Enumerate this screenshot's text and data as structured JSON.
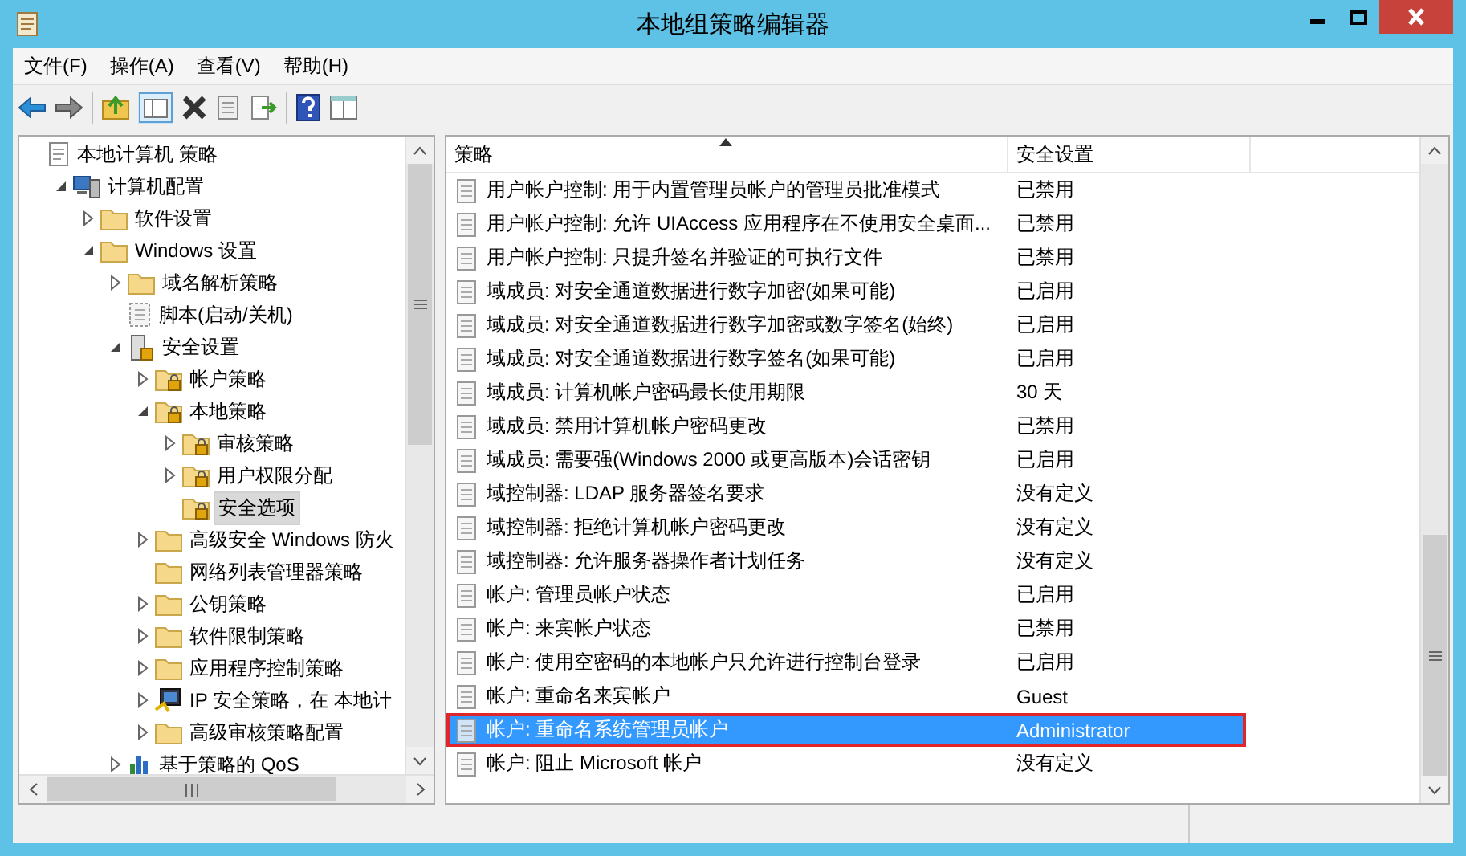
{
  "window": {
    "title": "本地组策略编辑器"
  },
  "menu": [
    "文件(F)",
    "操作(A)",
    "查看(V)",
    "帮助(H)"
  ],
  "tree": [
    {
      "label": "本地计算机 策略",
      "kind": "policy",
      "selected": false,
      "children": [
        {
          "label": "计算机配置",
          "kind": "computer",
          "expanded": true,
          "selected": false,
          "children": [
            {
              "label": "软件设置",
              "kind": "folder",
              "expanded": false,
              "selected": false
            },
            {
              "label": "Windows 设置",
              "kind": "folder",
              "expanded": true,
              "selected": false,
              "children": [
                {
                  "label": "域名解析策略",
                  "kind": "folder",
                  "expanded": false,
                  "selected": false
                },
                {
                  "label": "脚本(启动/关机)",
                  "kind": "script",
                  "selected": false
                },
                {
                  "label": "安全设置",
                  "kind": "security",
                  "expanded": true,
                  "selected": false,
                  "children": [
                    {
                      "label": "帐户策略",
                      "kind": "lockfolder",
                      "expanded": false,
                      "selected": false
                    },
                    {
                      "label": "本地策略",
                      "kind": "lockfolder",
                      "expanded": true,
                      "selected": false,
                      "children": [
                        {
                          "label": "审核策略",
                          "kind": "lockfolder",
                          "expanded": false,
                          "selected": false
                        },
                        {
                          "label": "用户权限分配",
                          "kind": "lockfolder",
                          "expanded": false,
                          "selected": false
                        },
                        {
                          "label": "安全选项",
                          "kind": "lockfolder",
                          "selected": true
                        }
                      ]
                    },
                    {
                      "label": "高级安全 Windows 防火",
                      "kind": "folder",
                      "expanded": false,
                      "selected": false
                    },
                    {
                      "label": "网络列表管理器策略",
                      "kind": "folder",
                      "selected": false
                    },
                    {
                      "label": "公钥策略",
                      "kind": "folder",
                      "expanded": false,
                      "selected": false
                    },
                    {
                      "label": "软件限制策略",
                      "kind": "folder",
                      "expanded": false,
                      "selected": false
                    },
                    {
                      "label": "应用程序控制策略",
                      "kind": "folder",
                      "expanded": false,
                      "selected": false
                    },
                    {
                      "label": "IP 安全策略，在 本地计",
                      "kind": "network",
                      "expanded": false,
                      "selected": false
                    },
                    {
                      "label": "高级审核策略配置",
                      "kind": "folder",
                      "expanded": false,
                      "selected": false
                    }
                  ]
                },
                {
                  "label": "基于策略的 QoS",
                  "kind": "chart",
                  "expanded": false,
                  "selected": false
                }
              ]
            }
          ]
        }
      ]
    }
  ],
  "table": {
    "columns": [
      "策略",
      "安全设置"
    ],
    "rows": [
      {
        "policy": "用户帐户控制: 用于内置管理员帐户的管理员批准模式",
        "setting": "已禁用",
        "selected": false,
        "outlined": false
      },
      {
        "policy": "用户帐户控制: 允许 UIAccess 应用程序在不使用安全桌面...",
        "setting": "已禁用",
        "selected": false,
        "outlined": false
      },
      {
        "policy": "用户帐户控制: 只提升签名并验证的可执行文件",
        "setting": "已禁用",
        "selected": false,
        "outlined": false
      },
      {
        "policy": "域成员: 对安全通道数据进行数字加密(如果可能)",
        "setting": "已启用",
        "selected": false,
        "outlined": false
      },
      {
        "policy": "域成员: 对安全通道数据进行数字加密或数字签名(始终)",
        "setting": "已启用",
        "selected": false,
        "outlined": false
      },
      {
        "policy": "域成员: 对安全通道数据进行数字签名(如果可能)",
        "setting": "已启用",
        "selected": false,
        "outlined": false
      },
      {
        "policy": "域成员: 计算机帐户密码最长使用期限",
        "setting": "30 天",
        "selected": false,
        "outlined": false
      },
      {
        "policy": "域成员: 禁用计算机帐户密码更改",
        "setting": "已禁用",
        "selected": false,
        "outlined": false
      },
      {
        "policy": "域成员: 需要强(Windows 2000 或更高版本)会话密钥",
        "setting": "已启用",
        "selected": false,
        "outlined": false
      },
      {
        "policy": "域控制器: LDAP 服务器签名要求",
        "setting": "没有定义",
        "selected": false,
        "outlined": false
      },
      {
        "policy": "域控制器: 拒绝计算机帐户密码更改",
        "setting": "没有定义",
        "selected": false,
        "outlined": false
      },
      {
        "policy": "域控制器: 允许服务器操作者计划任务",
        "setting": "没有定义",
        "selected": false,
        "outlined": false
      },
      {
        "policy": "帐户: 管理员帐户状态",
        "setting": "已启用",
        "selected": false,
        "outlined": false
      },
      {
        "policy": "帐户: 来宾帐户状态",
        "setting": "已禁用",
        "selected": false,
        "outlined": false
      },
      {
        "policy": "帐户: 使用空密码的本地帐户只允许进行控制台登录",
        "setting": "已启用",
        "selected": false,
        "outlined": false
      },
      {
        "policy": "帐户: 重命名来宾帐户",
        "setting": "Guest",
        "selected": false,
        "outlined": false
      },
      {
        "policy": "帐户: 重命名系统管理员帐户",
        "setting": "Administrator",
        "selected": true,
        "outlined": true
      },
      {
        "policy": "帐户: 阻止 Microsoft 帐户",
        "setting": "没有定义",
        "selected": false,
        "outlined": false
      }
    ]
  }
}
